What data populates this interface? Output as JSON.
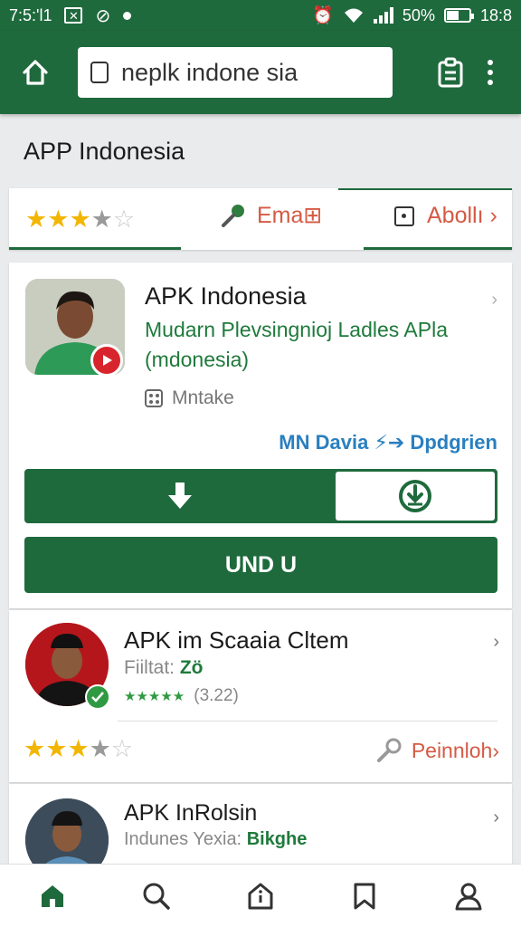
{
  "status_bar": {
    "time": "7:5:'l1",
    "battery": "50%",
    "clock_right": "18:8",
    "icons": [
      "mail-x-icon",
      "no-signal-icon",
      "dot-icon",
      "alarm-icon",
      "wifi-icon",
      "cell-signal-icon",
      "battery-icon"
    ]
  },
  "app_bar": {
    "search_value": "neplk indone sia",
    "icons": [
      "home-icon",
      "clipboard-icon",
      "more-vert-icon"
    ]
  },
  "section_title": "APP Indonesia",
  "filters": {
    "rating_stars": 3.5,
    "email_label": "Ema⊞",
    "about_label": "Abollı ›"
  },
  "card1": {
    "title": "APK Indonesia",
    "description": "Mudarn Plevsingnioj Ladles APla (mdonesia)",
    "meta": "Mntake",
    "developer": "MN Davia ⚡➔ Dpdgrien",
    "primary_button": "UND U",
    "chevron": "›"
  },
  "card2": {
    "title": "APK im Scaaia Cltem",
    "sub_label": "Fiiltat:",
    "sub_value": "Zö",
    "mini_stars": "★★★★★",
    "rating_count": "(3.22)",
    "rating_stars": 3.5,
    "link_label": "Peinnloh›",
    "chevron": "›"
  },
  "card3": {
    "title": "APK InRolsin",
    "sub_label": "Indunes Yexia:",
    "sub_value": "Bikghe",
    "chevron": "›"
  },
  "bottom_nav": [
    "home-icon",
    "search-icon",
    "house-info-icon",
    "bookmark-icon",
    "profile-icon"
  ],
  "colors": {
    "primary_green": "#1f6a3d",
    "accent_text_green": "#1f7a3c",
    "link_orange": "#d55a44",
    "dev_blue": "#2a7fbf",
    "star_gold": "#f2b600"
  }
}
